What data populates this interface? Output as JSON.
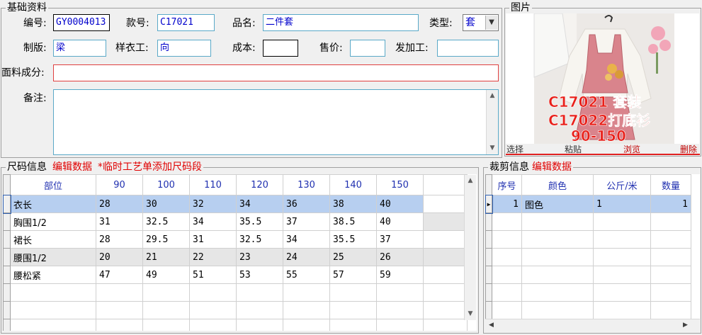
{
  "basic": {
    "legend": "基础资料",
    "code_label": "编号:",
    "code_value": "GY0004013",
    "style_label": "款号:",
    "style_value": "C17021",
    "name_label": "品名:",
    "name_value": "二件套",
    "type_label": "类型:",
    "type_value": "套",
    "pattern_label": "制版:",
    "pattern_value": "梁",
    "sample_label": "样衣工:",
    "sample_value": "向",
    "cost_label": "成本:",
    "cost_value": "",
    "price_label": "售价:",
    "price_value": "",
    "processor_label": "发加工:",
    "processor_value": "",
    "fabric_label": "面料成分:",
    "fabric_value": "",
    "note_label": "备注:",
    "note_value": ""
  },
  "picture": {
    "legend": "图片",
    "overlay_line1": "C17021 套装",
    "overlay_line2": "C17022打底衫",
    "overlay_line3": "90-150",
    "actions": [
      "选择",
      "粘贴",
      "浏览",
      "删除"
    ],
    "colors": {
      "overlay": "#e8201a",
      "dress": "#d9848c",
      "shirt": "#f7f5f0",
      "flowers": "#f2a6b8"
    }
  },
  "sizes": {
    "legend": "尺码信息",
    "edit_link": "编辑数据",
    "note": "*临时工艺单添加尺码段",
    "columns": [
      "部位",
      "90",
      "100",
      "110",
      "120",
      "130",
      "140",
      "150"
    ],
    "rows": [
      [
        "衣长",
        "28",
        "30",
        "32",
        "34",
        "36",
        "38",
        "40"
      ],
      [
        "胸围1/2",
        "31",
        "32.5",
        "34",
        "35.5",
        "37",
        "38.5",
        "40"
      ],
      [
        "裙长",
        "28",
        "29.5",
        "31",
        "32.5",
        "34",
        "35.5",
        "37"
      ],
      [
        "腰围1/2",
        "20",
        "21",
        "22",
        "23",
        "24",
        "25",
        "26"
      ],
      [
        "腰松紧",
        "47",
        "49",
        "51",
        "53",
        "55",
        "57",
        "59"
      ]
    ]
  },
  "cutting": {
    "legend": "裁剪信息",
    "edit_link": "编辑数据",
    "columns": [
      "序号",
      "颜色",
      "公斤/米",
      "数量"
    ],
    "rows": [
      [
        "1",
        "图色",
        "1",
        "1"
      ]
    ]
  }
}
